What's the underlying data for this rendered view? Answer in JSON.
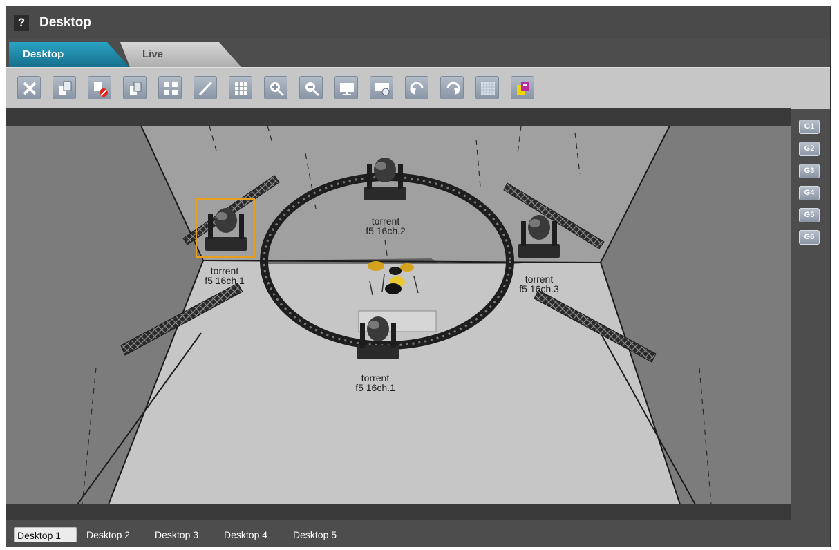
{
  "window": {
    "title": "Desktop",
    "help_label": "?"
  },
  "tabs": [
    {
      "label": "Desktop",
      "active": true
    },
    {
      "label": "Live",
      "active": false
    }
  ],
  "toolbar": {
    "buttons": [
      {
        "icon": "close-icon"
      },
      {
        "icon": "copy-fixture-icon"
      },
      {
        "icon": "delete-fixture-icon"
      },
      {
        "icon": "duplicate-icon"
      },
      {
        "icon": "arrange-grid-icon"
      },
      {
        "icon": "pen-icon"
      },
      {
        "icon": "grid-icon"
      },
      {
        "icon": "zoom-in-icon"
      },
      {
        "icon": "zoom-out-icon"
      },
      {
        "icon": "monitor-icon"
      },
      {
        "icon": "camera-icon"
      },
      {
        "icon": "undo-icon"
      },
      {
        "icon": "redo-icon"
      },
      {
        "icon": "dots-grid-icon"
      },
      {
        "icon": "palette-icon"
      }
    ]
  },
  "scene": {
    "fixtures": [
      {
        "name": "torrent",
        "mode": "f5 16ch.1",
        "selected": true
      },
      {
        "name": "torrent",
        "mode": "f5 16ch.2",
        "selected": false
      },
      {
        "name": "torrent",
        "mode": "f5 16ch.3",
        "selected": false
      },
      {
        "name": "torrent",
        "mode": "f5 16ch.1",
        "selected": false
      }
    ]
  },
  "groups": [
    "G1",
    "G2",
    "G3",
    "G4",
    "G5",
    "G6"
  ],
  "desktop_tabs": [
    {
      "label": "Desktop 1",
      "active": true
    },
    {
      "label": "Desktop 2",
      "active": false
    },
    {
      "label": "Desktop 3",
      "active": false
    },
    {
      "label": "Desktop 4",
      "active": false
    },
    {
      "label": "Desktop 5",
      "active": false
    }
  ],
  "colors": {
    "accent_tab": "#1f8ba8",
    "selection": "#e6a020",
    "chrome": "#4d4d4d",
    "toolbar": "#c6c6c6"
  }
}
